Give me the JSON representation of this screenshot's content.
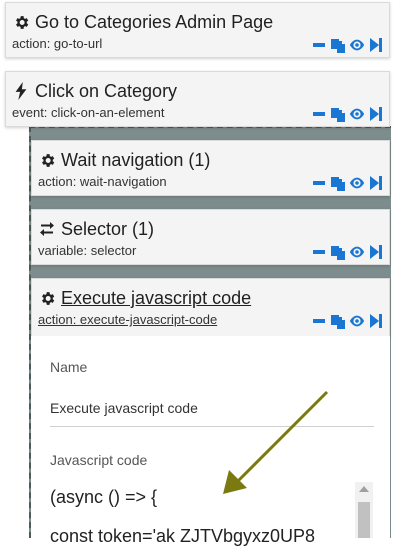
{
  "steps": [
    {
      "title": "Go to Categories Admin Page",
      "subtitle": "action: go-to-url",
      "icon": "gear-icon"
    },
    {
      "title": "Click on Category",
      "subtitle": "event: click-on-an-element",
      "icon": "lightning-icon"
    },
    {
      "title": "Wait navigation (1)",
      "subtitle": "action: wait-navigation",
      "icon": "gear-icon"
    },
    {
      "title": "Selector (1)",
      "subtitle": "variable: selector",
      "icon": "swap-arrows-icon"
    },
    {
      "title": "Execute javascript code",
      "subtitle": "action: execute-javascript-code",
      "icon": "gear-icon"
    }
  ],
  "action_icons": [
    "minus-icon",
    "copy-icon",
    "eye-icon",
    "skip-icon"
  ],
  "detail": {
    "name_label": "Name",
    "name_value": "Execute javascript code",
    "code_label": "Javascript code",
    "code_lines": [
      "(async () => {",
      "  const token='ak ZJTVbgyxz0UP8"
    ]
  },
  "colors": {
    "accent": "#1976d2",
    "card_bg": "#f4f4f4",
    "nest_bg": "#7d8c8c",
    "annotation_arrow": "#7a7a10"
  }
}
